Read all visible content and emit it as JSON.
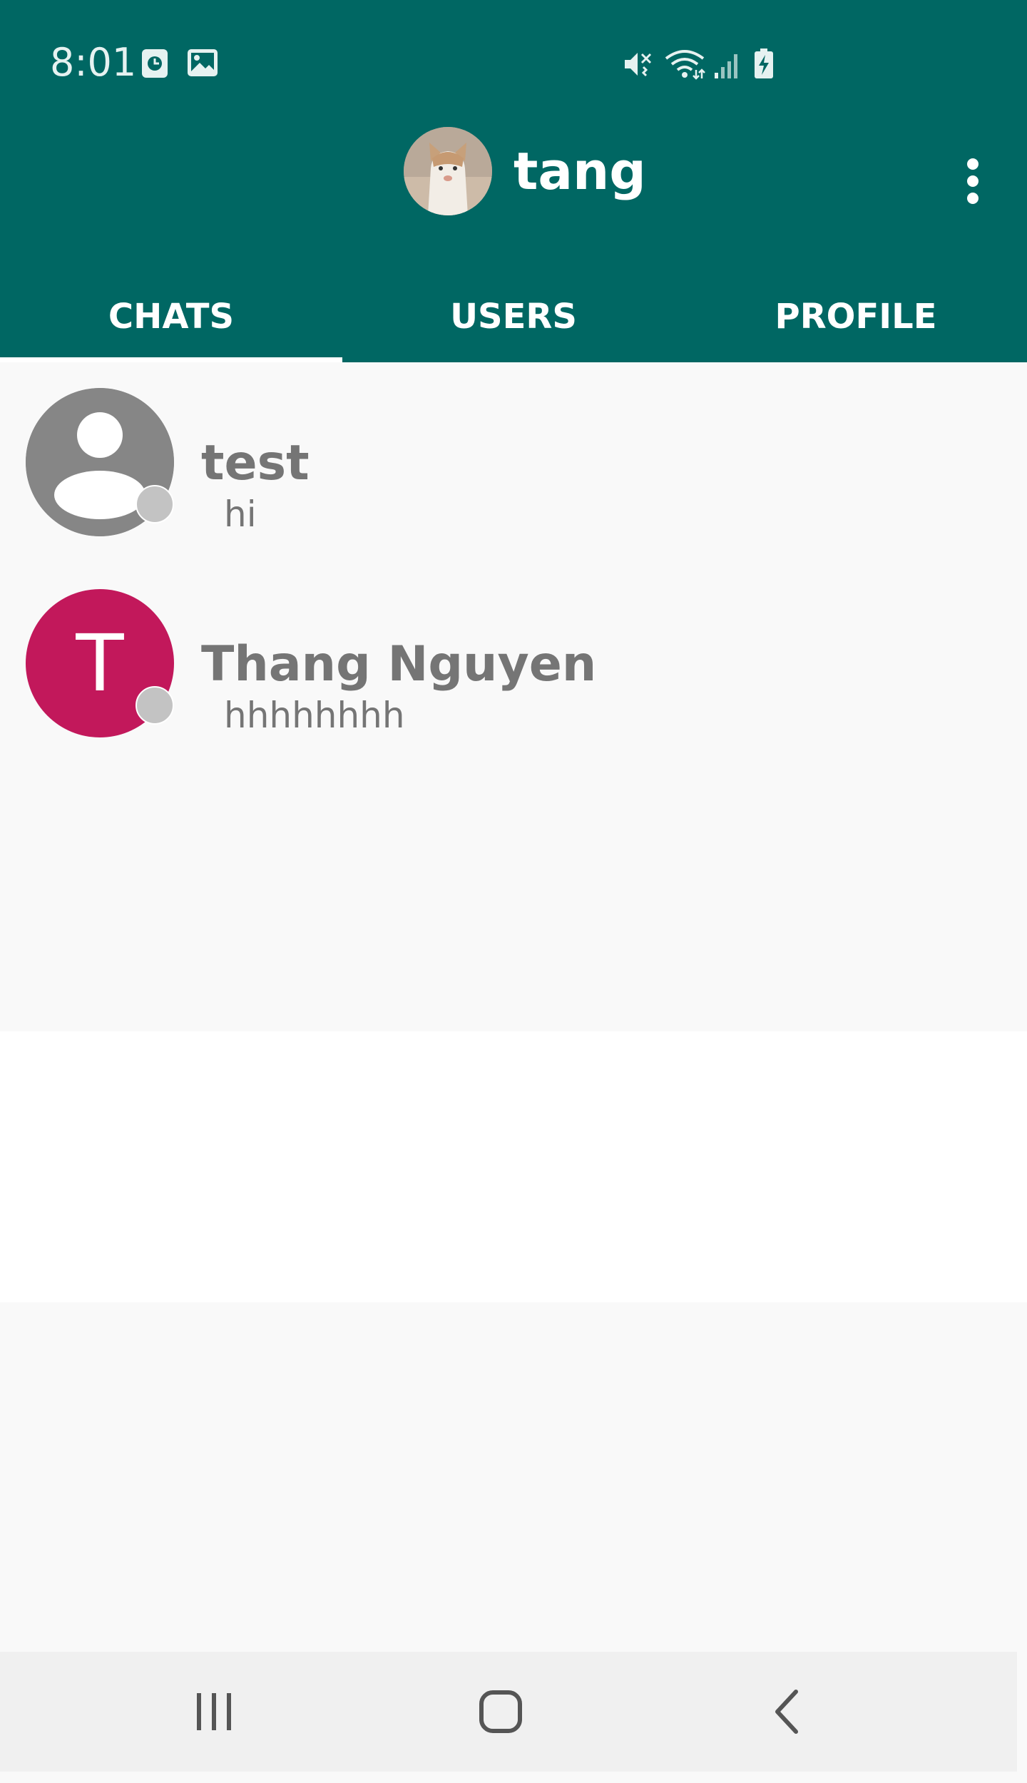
{
  "status_bar": {
    "time": "8:01",
    "icons": [
      "clock-notification-icon",
      "image-notification-icon",
      "mute-vibrate-icon",
      "wifi-icon",
      "cellular-signal-icon",
      "battery-charging-icon"
    ]
  },
  "header": {
    "username": "tang",
    "avatar_icon": "cat-avatar-photo",
    "menu_icon": "more-vert-icon"
  },
  "tabs": [
    {
      "label": "CHATS",
      "selected": true
    },
    {
      "label": "USERS",
      "selected": false
    },
    {
      "label": "PROFILE",
      "selected": false
    }
  ],
  "chats": [
    {
      "name": "test",
      "last_message": "hi",
      "avatar_type": "default-person-icon",
      "status": "offline"
    },
    {
      "name": "Thang Nguyen",
      "last_message": "hhhhhhhh",
      "avatar_letter": "T",
      "avatar_color": "#C2185B",
      "status": "offline"
    }
  ],
  "nav_bar": {
    "buttons": [
      "recent-apps-icon",
      "home-icon",
      "back-icon"
    ]
  },
  "colors": {
    "primary": "#006763",
    "text_secondary": "#757575",
    "status_offline": "#C3C3C3",
    "background": "#F9F9F9"
  }
}
